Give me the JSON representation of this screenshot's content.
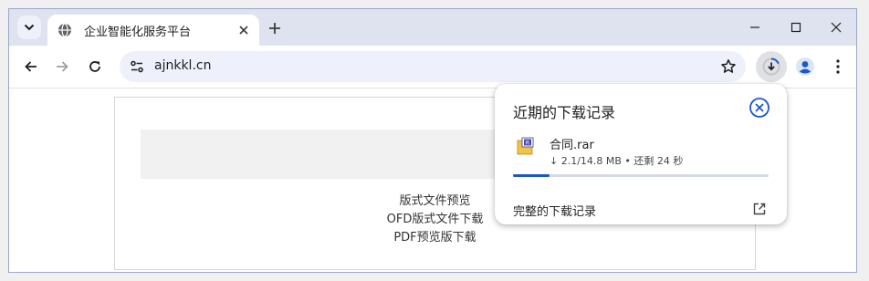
{
  "browser": {
    "tab": {
      "title": "企业智能化服务平台",
      "favicon": "globe-icon",
      "close_icon": "close-icon"
    },
    "tab_search_icon": "chevron-down-icon",
    "new_tab_icon": "plus-icon",
    "window_controls": [
      "minimize-icon",
      "maximize-icon",
      "close-icon"
    ],
    "toolbar": {
      "back_icon": "arrow-left-icon",
      "forward_icon": "arrow-right-icon",
      "reload_icon": "reload-icon",
      "url": "ajnkkl.cn",
      "site_info_icon": "tune-icon",
      "bookmark_icon": "star-icon",
      "download_icon": "download-icon",
      "profile_icon": "person-icon",
      "menu_icon": "more-vert-icon"
    }
  },
  "page": {
    "links": [
      "版式文件预览",
      "OFD版式文件下载",
      "PDF预览版下载"
    ]
  },
  "download_bubble": {
    "title": "近期的下载记录",
    "item": {
      "filename": "合同.rar",
      "status": "↓ 2.1/14.8 MB • 还剩 24 秒",
      "progress": 0.142,
      "file_icon": "rar-archive-icon"
    },
    "full_history_label": "完整的下载记录",
    "open_icon": "open-in-new-icon",
    "accent": "#1a57c9"
  }
}
